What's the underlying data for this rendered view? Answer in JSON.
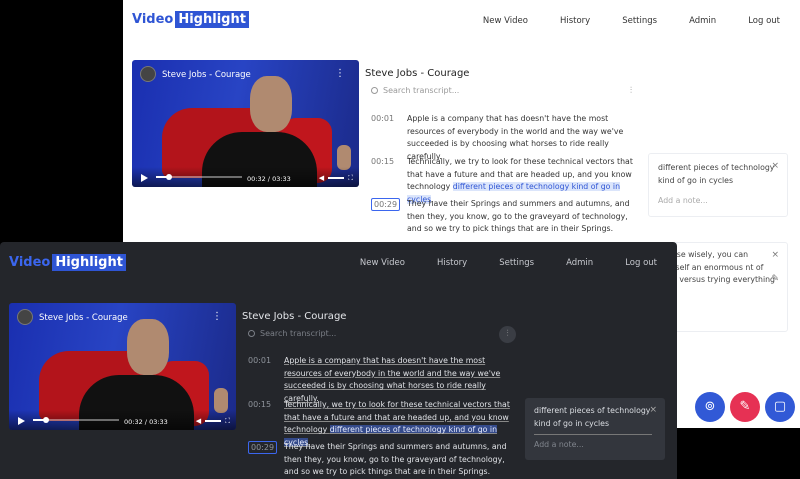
{
  "logo": {
    "word1": "Video",
    "word2": "Highlight"
  },
  "nav": [
    "New Video",
    "History",
    "Settings",
    "Admin",
    "Log out"
  ],
  "video": {
    "title": "Steve Jobs - Courage",
    "time": "00:32",
    "duration": "03:33",
    "progress": 0.15
  },
  "page_title": "Steve Jobs - Courage",
  "search_placeholder": "Search transcript...",
  "filter_icon": "sliders-icon",
  "transcript": [
    {
      "ts": "00:01",
      "text": "Apple is a company that has doesn't have the most resources of everybody in the world and the way we've succeeded is by choosing what horses to ride really carefully."
    },
    {
      "ts": "00:15",
      "pre": "Technically, we try to look for these technical vectors that that have a future and that are headed up, and you know technology ",
      "hl": "different pieces of technology kind of go in cycles",
      "post": "."
    },
    {
      "ts": "00:29",
      "text": "They have their Springs and summers and autumns, and then they, you know, go to the graveyard of technology, and so we try to pick things that are in their Springs."
    }
  ],
  "note1": {
    "quote": "different pieces of technology kind of go in cycles",
    "add": "Add a note...",
    "close": "×"
  },
  "note2": {
    "quote": "choose wisely, you can yourself an enormous nt of work versus trying everything",
    "add": "e...",
    "close": "×",
    "edit": "✎"
  },
  "fabs": {
    "help_icon": "lifebuoy-icon",
    "highlight_icon": "pencil-icon",
    "chat_icon": "chat-icon"
  },
  "colors": {
    "accent": "#2f55d4",
    "dark_bg": "#24262b",
    "pink": "#e63154"
  }
}
